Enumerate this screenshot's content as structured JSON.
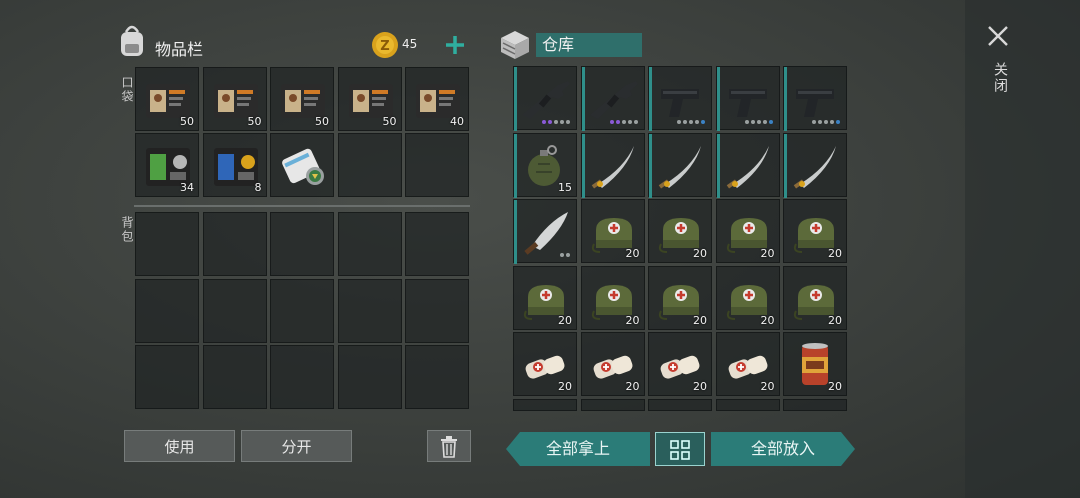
{
  "inventory": {
    "title": "物品栏",
    "coins": "45",
    "pocket_label": "口袋",
    "backpack_label": "背包",
    "pocket_slots": [
      {
        "item": "id-card-brown",
        "count": "50"
      },
      {
        "item": "id-card-brown",
        "count": "50"
      },
      {
        "item": "id-card-brown",
        "count": "50"
      },
      {
        "item": "id-card-brown",
        "count": "50"
      },
      {
        "item": "id-card-brown",
        "count": "40"
      },
      {
        "item": "id-card-green",
        "count": "34"
      },
      {
        "item": "id-card-blue",
        "count": "8"
      },
      {
        "item": "map-scroll",
        "count": ""
      },
      {
        "item": "empty",
        "count": ""
      },
      {
        "item": "empty",
        "count": ""
      }
    ],
    "use_label": "使用",
    "split_label": "分开"
  },
  "storage": {
    "title": "仓库",
    "take_all_label": "全部拿上",
    "put_all_label": "全部放入",
    "slots": [
      {
        "item": "rifle",
        "count": ""
      },
      {
        "item": "rifle",
        "count": ""
      },
      {
        "item": "pistol",
        "count": ""
      },
      {
        "item": "pistol",
        "count": ""
      },
      {
        "item": "pistol",
        "count": ""
      },
      {
        "item": "grenade",
        "count": "15"
      },
      {
        "item": "katana",
        "count": ""
      },
      {
        "item": "katana",
        "count": ""
      },
      {
        "item": "katana",
        "count": ""
      },
      {
        "item": "katana",
        "count": ""
      },
      {
        "item": "machete",
        "count": ""
      },
      {
        "item": "medkit-bag",
        "count": "20"
      },
      {
        "item": "medkit-bag",
        "count": "20"
      },
      {
        "item": "medkit-bag",
        "count": "20"
      },
      {
        "item": "medkit-bag",
        "count": "20"
      },
      {
        "item": "medkit-bag",
        "count": "20"
      },
      {
        "item": "medkit-bag",
        "count": "20"
      },
      {
        "item": "medkit-bag",
        "count": "20"
      },
      {
        "item": "medkit-bag",
        "count": "20"
      },
      {
        "item": "medkit-bag",
        "count": "20"
      },
      {
        "item": "bandage",
        "count": "20"
      },
      {
        "item": "bandage",
        "count": "20"
      },
      {
        "item": "bandage",
        "count": "20"
      },
      {
        "item": "bandage",
        "count": "20"
      },
      {
        "item": "food-can",
        "count": "20"
      }
    ]
  },
  "close_label": "关闭",
  "colors": {
    "accent": "#2f8f8a",
    "coin": "#d9a21c",
    "plus": "#2fae9f"
  }
}
